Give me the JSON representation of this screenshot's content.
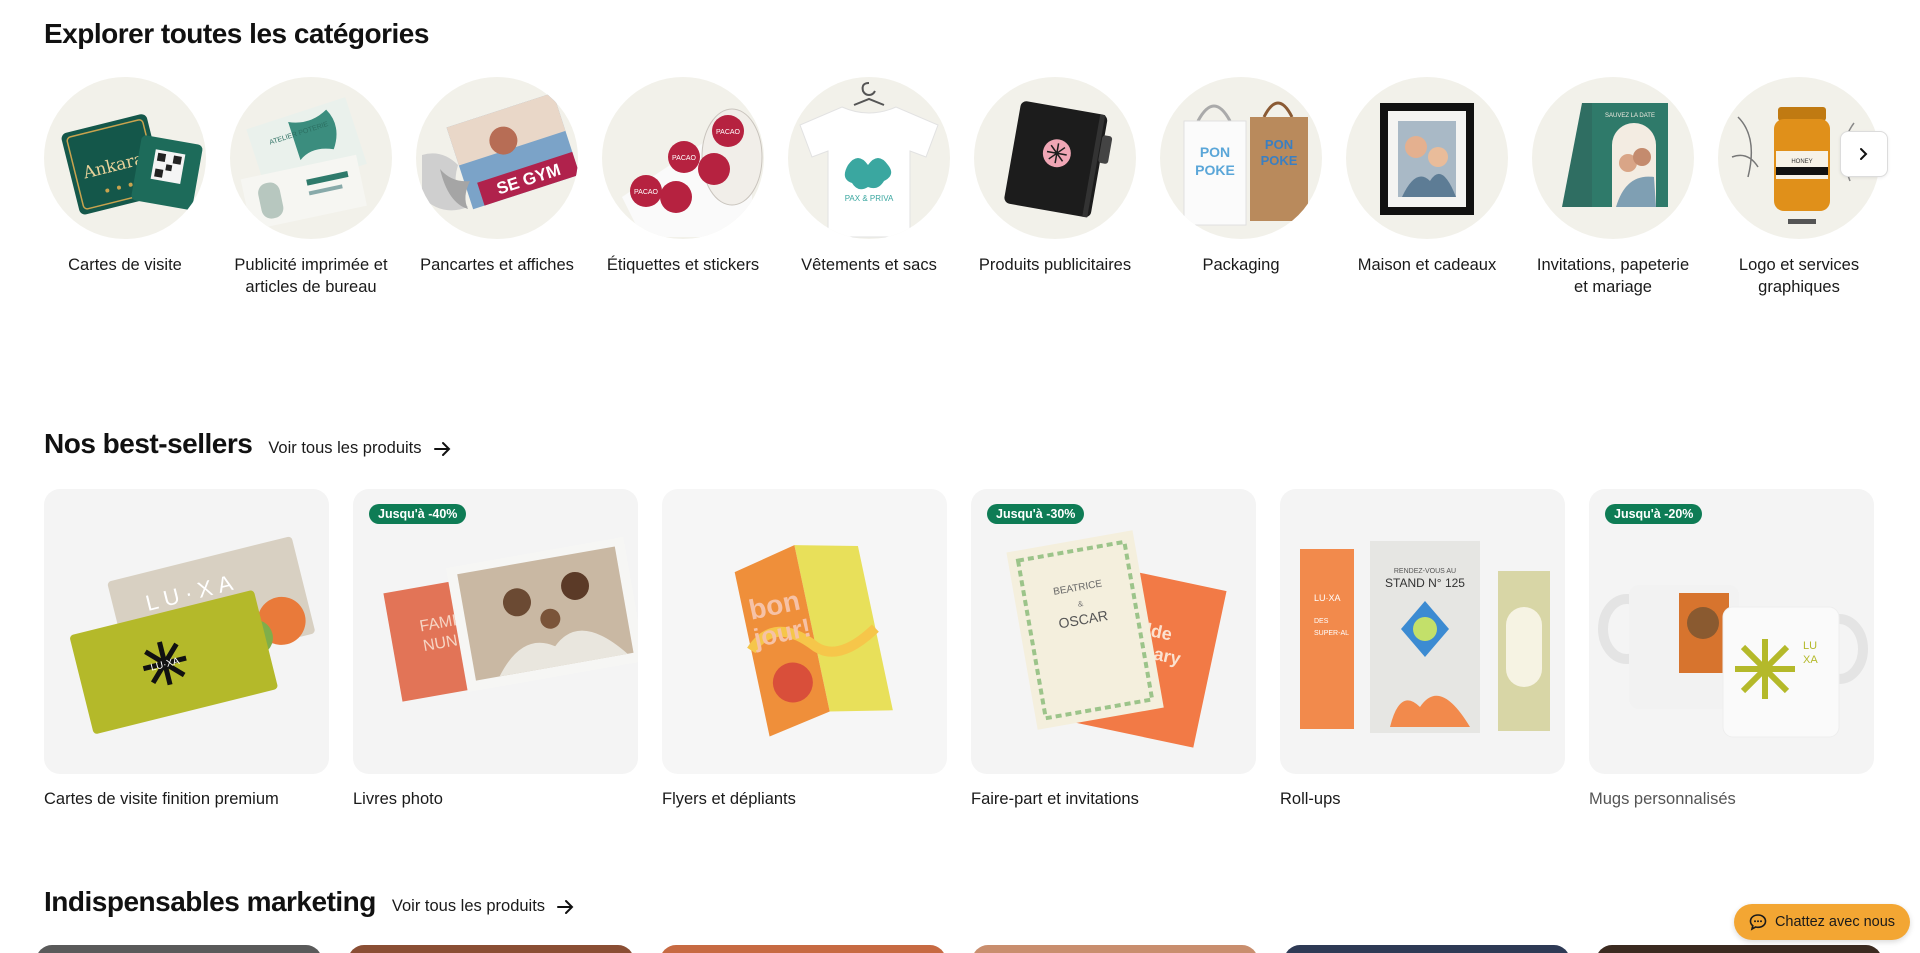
{
  "categories": {
    "title": "Explorer toutes les catégories",
    "items": [
      {
        "label": "Cartes de visite",
        "icon": "business-cards-icon"
      },
      {
        "label": "Publicité imprimée et articles de bureau",
        "icon": "print-advertising-icon"
      },
      {
        "label": "Pancartes et affiches",
        "icon": "posters-icon"
      },
      {
        "label": "Étiquettes et stickers",
        "icon": "stickers-icon"
      },
      {
        "label": "Vêtements et sacs",
        "icon": "tshirt-icon"
      },
      {
        "label": "Produits publicitaires",
        "icon": "notebook-icon"
      },
      {
        "label": "Packaging",
        "icon": "bags-icon"
      },
      {
        "label": "Maison et cadeaux",
        "icon": "frame-icon"
      },
      {
        "label": "Invitations, papeterie et mariage",
        "icon": "invitation-icon"
      },
      {
        "label": "Logo et services graphiques",
        "icon": "jar-logo-icon"
      }
    ],
    "next_icon": "chevron-right-icon"
  },
  "bestsellers": {
    "title": "Nos best-sellers",
    "see_all": "Voir tous les produits",
    "items": [
      {
        "label": "Cartes de visite finition premium",
        "badge": ""
      },
      {
        "label": "Livres photo",
        "badge": "Jusqu'à -40%"
      },
      {
        "label": "Flyers et dépliants",
        "badge": ""
      },
      {
        "label": "Faire-part et invitations",
        "badge": "Jusqu'à -30%"
      },
      {
        "label": "Roll-ups",
        "badge": ""
      },
      {
        "label": "Mugs personnalisés",
        "badge": "Jusqu'à -20%"
      }
    ]
  },
  "marketing": {
    "title": "Indispensables marketing",
    "see_all": "Voir tous les produits"
  },
  "chat": {
    "label": "Chattez avec nous",
    "icon": "chat-bubble-icon"
  },
  "colors": {
    "badge": "#0e7c55",
    "chat": "#f3a633",
    "circle_bg": "#f2f1ea"
  }
}
